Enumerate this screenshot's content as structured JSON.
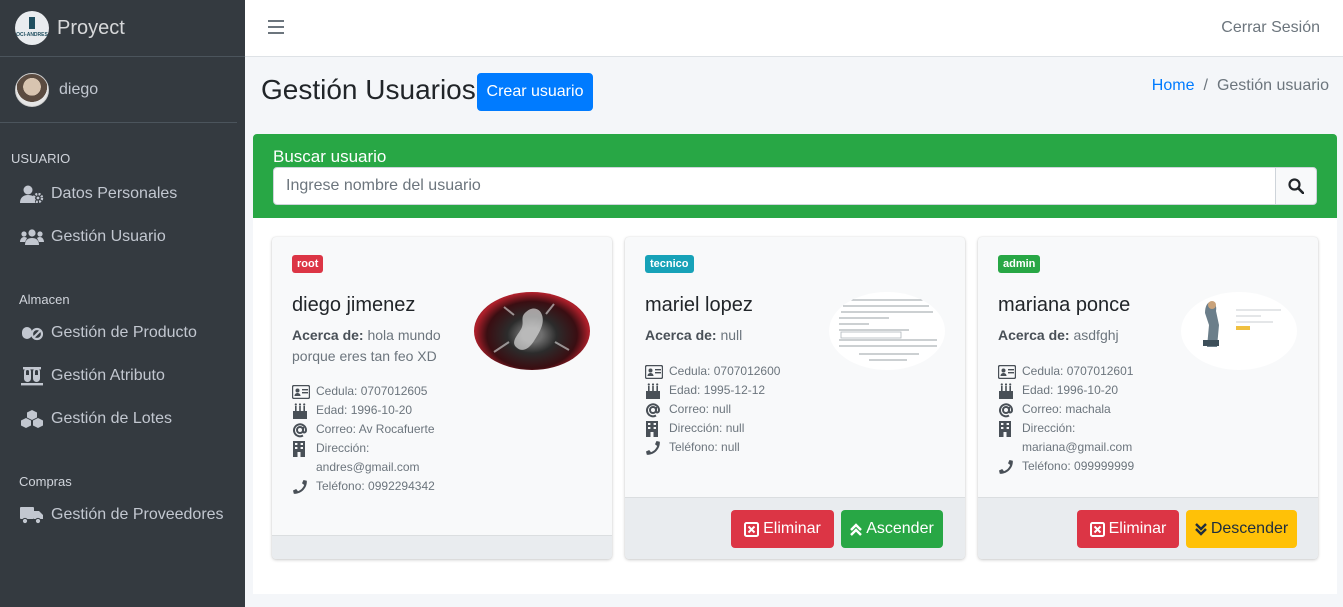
{
  "brand": {
    "name": "Proyect",
    "logo_text": "OCI-ANDRES"
  },
  "user": {
    "name": "diego"
  },
  "sidebar": {
    "sections": [
      {
        "header": "USUARIO",
        "items": [
          {
            "label": "Datos Personales",
            "icon": "user-cog-icon"
          },
          {
            "label": "Gestión Usuario",
            "icon": "users-icon"
          }
        ]
      },
      {
        "header": "Almacen",
        "items": [
          {
            "label": "Gestión de Producto",
            "icon": "pills-icon"
          },
          {
            "label": "Gestión Atributo",
            "icon": "flask-icon"
          },
          {
            "label": "Gestión de Lotes",
            "icon": "cubes-icon"
          }
        ]
      },
      {
        "header": "Compras",
        "items": [
          {
            "label": "Gestión de Proveedores",
            "icon": "truck-icon"
          }
        ]
      }
    ]
  },
  "topbar": {
    "logout": "Cerrar Sesión"
  },
  "page": {
    "title": "Gestión Usuarios",
    "create_button": "Crear usuario",
    "breadcrumb": {
      "home": "Home",
      "separator": "/",
      "current": "Gestión usuario"
    }
  },
  "search": {
    "title": "Buscar usuario",
    "placeholder": "Ingrese nombre del usuario"
  },
  "labels": {
    "about": "Acerca de:",
    "cedula": "Cedula:",
    "edad": "Edad:",
    "correo": "Correo:",
    "direccion": "Dirección:",
    "telefono": "Teléfono:",
    "delete": "Eliminar",
    "promote": "Ascender",
    "demote": "Descender"
  },
  "users": [
    {
      "role": "root",
      "name": "diego jimenez",
      "about": "hola mundo porque eres tan feo XD",
      "cedula": "0707012605",
      "edad": "1996-10-20",
      "correo": "Av Rocafuerte",
      "direccion": "andres@gmail.com",
      "telefono": "0992294342"
    },
    {
      "role": "tecnico",
      "name": "mariel lopez",
      "about": "null",
      "cedula": "0707012600",
      "edad": "1995-12-12",
      "correo": "null",
      "direccion": "null",
      "telefono": "null"
    },
    {
      "role": "admin",
      "name": "mariana ponce",
      "about": "asdfghj",
      "cedula": "0707012601",
      "edad": "1996-10-20",
      "correo": "machala",
      "direccion": "mariana@gmail.com",
      "telefono": "099999999"
    }
  ],
  "colors": {
    "sidebar": "#343a40",
    "primary": "#007bff",
    "success": "#28a745",
    "danger": "#dc3545",
    "warning": "#ffc107",
    "info": "#17a2b8"
  }
}
